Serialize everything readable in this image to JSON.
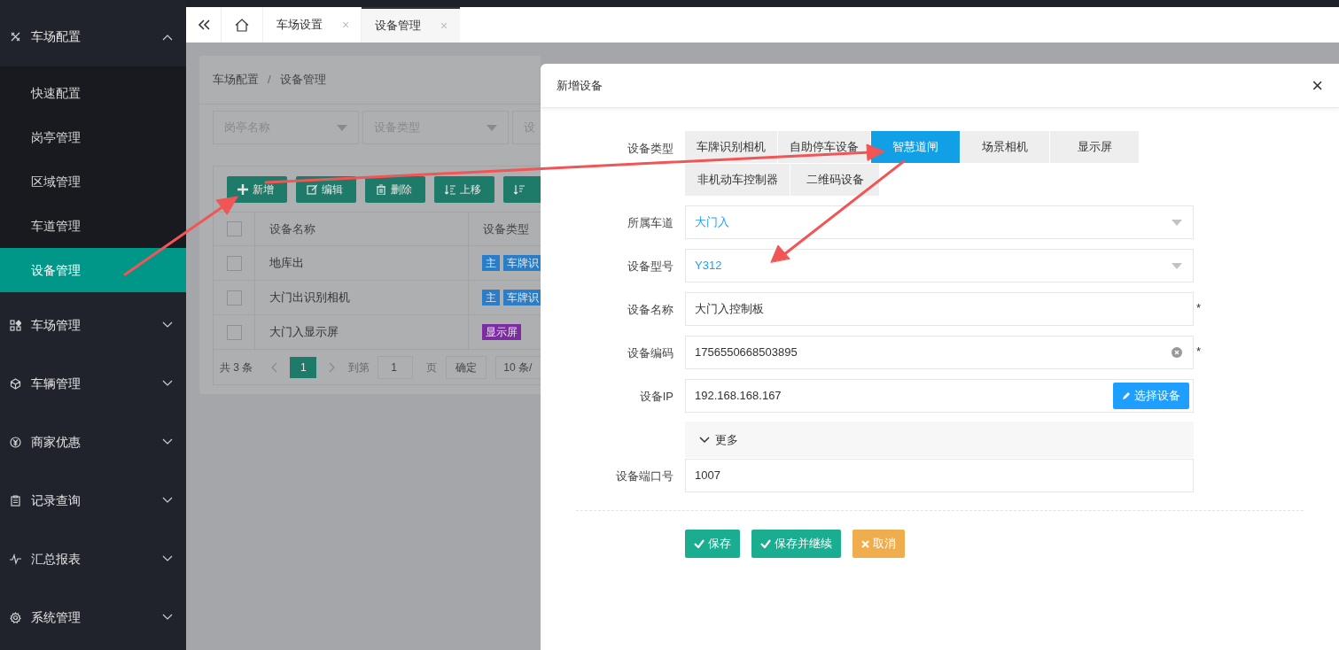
{
  "sidebar": {
    "groups": [
      {
        "label": "车场配置",
        "expanded": true,
        "children": [
          {
            "label": "快速配置",
            "selected": false
          },
          {
            "label": "岗亭管理",
            "selected": false
          },
          {
            "label": "区域管理",
            "selected": false
          },
          {
            "label": "车道管理",
            "selected": false
          },
          {
            "label": "设备管理",
            "selected": true
          }
        ]
      },
      {
        "label": "车场管理",
        "expanded": false
      },
      {
        "label": "车辆管理",
        "expanded": false
      },
      {
        "label": "商家优惠",
        "expanded": false
      },
      {
        "label": "记录查询",
        "expanded": false
      },
      {
        "label": "汇总报表",
        "expanded": false
      },
      {
        "label": "系统管理",
        "expanded": false
      }
    ]
  },
  "tabs": [
    {
      "label": "车场设置",
      "selected": false,
      "close": "×"
    },
    {
      "label": "设备管理",
      "selected": true,
      "close": "×"
    }
  ],
  "page": {
    "breadcrumb": [
      "车场配置",
      "设备管理"
    ],
    "separator": "/",
    "filters": [
      {
        "placeholder": "岗亭名称",
        "dropdown": true
      },
      {
        "placeholder": "设备类型",
        "dropdown": true
      },
      {
        "placeholder": "设"
      }
    ],
    "toolbar": [
      {
        "kind": "add",
        "label": "新增"
      },
      {
        "kind": "edit",
        "label": "编辑"
      },
      {
        "kind": "delete",
        "label": "删除"
      },
      {
        "kind": "move_up",
        "label": "上移"
      },
      {
        "kind": "move_down"
      }
    ],
    "table": {
      "all_checked": false,
      "columns": [
        "设备名称",
        "设备类型"
      ],
      "rows": [
        {
          "name": "地库出",
          "checked": false,
          "tags": [
            {
              "text": "主",
              "color": "#2a7dc6"
            },
            {
              "text": "车牌识",
              "color": "#2a7dc6"
            }
          ]
        },
        {
          "name": "大门出识别相机",
          "checked": false,
          "tags": [
            {
              "text": "主",
              "color": "#2a7dc6"
            },
            {
              "text": "车牌识",
              "color": "#2a7dc6"
            }
          ]
        },
        {
          "name": "大门入显示屏",
          "checked": false,
          "tags": [
            {
              "text": "显示屏",
              "color": "#7a2ca0"
            }
          ]
        }
      ]
    },
    "pager": {
      "total": "共 3 条",
      "page": "1",
      "goto": "到第",
      "goto_value": "1",
      "page_unit": "页",
      "confirm": "确定",
      "size": "10 条/"
    }
  },
  "modal": {
    "title": "新增设备",
    "close": "×",
    "type_label": "设备类型",
    "types": [
      {
        "label": "车牌识别相机",
        "selected": false
      },
      {
        "label": "自助停车设备",
        "selected": false
      },
      {
        "label": "智慧道闸",
        "selected": true
      },
      {
        "label": "场景相机",
        "selected": false
      },
      {
        "label": "显示屏",
        "selected": false
      },
      {
        "label": "非机动车控制器",
        "selected": false
      },
      {
        "label": "二维码设备",
        "selected": false
      }
    ],
    "fields": [
      {
        "kind": "select",
        "label": "所属车道",
        "value": "大门入"
      },
      {
        "kind": "select",
        "label": "设备型号",
        "value": "Y312"
      },
      {
        "kind": "input",
        "label": "设备名称",
        "value": "大门入控制板",
        "required_mark": "*"
      },
      {
        "kind": "input",
        "label": "设备编码",
        "value": "1756550668503895",
        "required_mark": "*",
        "clearable": true
      },
      {
        "kind": "input",
        "label": "设备IP",
        "value": "192.168.168.167",
        "button": "选择设备"
      },
      {
        "kind": "collapse",
        "label": "更多",
        "expanded": true
      },
      {
        "kind": "input",
        "label": "设备端口号",
        "value": "1007"
      }
    ],
    "buttons": [
      {
        "kind": "save",
        "label": "保存"
      },
      {
        "kind": "save",
        "label": "保存并继续"
      },
      {
        "kind": "cancel",
        "label": "取消"
      }
    ]
  }
}
